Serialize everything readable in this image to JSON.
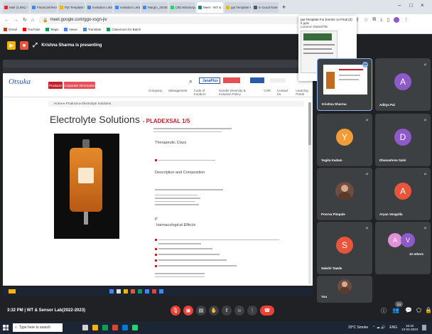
{
  "browser": {
    "tabs": [
      {
        "label": "Mail (4,591) - yu",
        "color": "#d93025"
      },
      {
        "label": "Financial literacy",
        "color": "#4285f4"
      },
      {
        "label": "Ppt Template for",
        "color": "#f4b400"
      },
      {
        "label": "Invitation Letter c",
        "color": "#4285f4"
      },
      {
        "label": "Invitation Letter c",
        "color": "#4285f4"
      },
      {
        "label": "Margin_2023041",
        "color": "#4285f4"
      },
      {
        "label": "(39) WhatsApp",
        "color": "#25d366"
      },
      {
        "label": "Meet - WT &",
        "color": "#00897b",
        "active": true
      },
      {
        "label": "ppt Template For",
        "color": "#f4b400"
      },
      {
        "label": "In Good Note of T",
        "color": "#555555"
      }
    ],
    "url": "meet.google.com/ggo-xsgn-jiv",
    "bookmarks": [
      "Gmail",
      "YouTube",
      "Maps",
      "News",
      "Translate",
      "Classroom for Batch"
    ]
  },
  "tooltip": {
    "title": "ppt Template For Events 14 Final (3)",
    "line2": "5 pptx",
    "line3": "Local or shared file"
  },
  "meet": {
    "presenter": "Krishna Sharma is presenting",
    "meeting_info": "3:32 PM | WT & Sensor Lab(2022-2023)"
  },
  "website": {
    "logo": "Otsuka",
    "nav_products": "Products",
    "nav_corporate": "Corporate Information",
    "nav_links": [
      "Company",
      "Management",
      "Code of Conduct",
      "Gender Diversity & Inclusion Policy",
      "CSR",
      "Contact Us",
      "Learning Portal"
    ],
    "brand": "JanaPlus",
    "breadcrumb": "Home ▸ Products ▸ Electrolyte Solutions",
    "title": "Electrolyte Solutions",
    "product": "- PLADEXSAL 1/5",
    "sections": [
      "Therapeutic Class",
      "Description and Composition",
      "harmacological Effects"
    ],
    "section_prefix": "P"
  },
  "participants": [
    {
      "name": "Krishna Sharma",
      "initial": "",
      "color": "#5f6368"
    },
    {
      "name": "Aditya Pal",
      "initial": "A",
      "color": "#8e5ac9"
    },
    {
      "name": "Yogita Kadam",
      "initial": "Y",
      "color": "#f29c38"
    },
    {
      "name": "Dhanashree Salvi",
      "initial": "D",
      "color": "#8e5ac9"
    },
    {
      "name": "Poorva Pimpale",
      "initial": "",
      "color": "#6d4c41"
    },
    {
      "name": "Aryan Vengolla",
      "initial": "A",
      "color": "#e8553b"
    },
    {
      "name": "Sakshi Tawde",
      "initial": "S",
      "color": "#e8553b"
    },
    {
      "name": "10 others",
      "initial": "A",
      "color": "#8e5ac9"
    },
    {
      "name": "You",
      "initial": "",
      "color": "#6d4c41"
    }
  ],
  "others_second_initial": "V",
  "participant_count": "24",
  "taskbar": {
    "search_placeholder": "Type here to search",
    "weather": "29°C Smoke",
    "lang": "ENG",
    "time": "15:32",
    "date": "13-04-2023"
  }
}
